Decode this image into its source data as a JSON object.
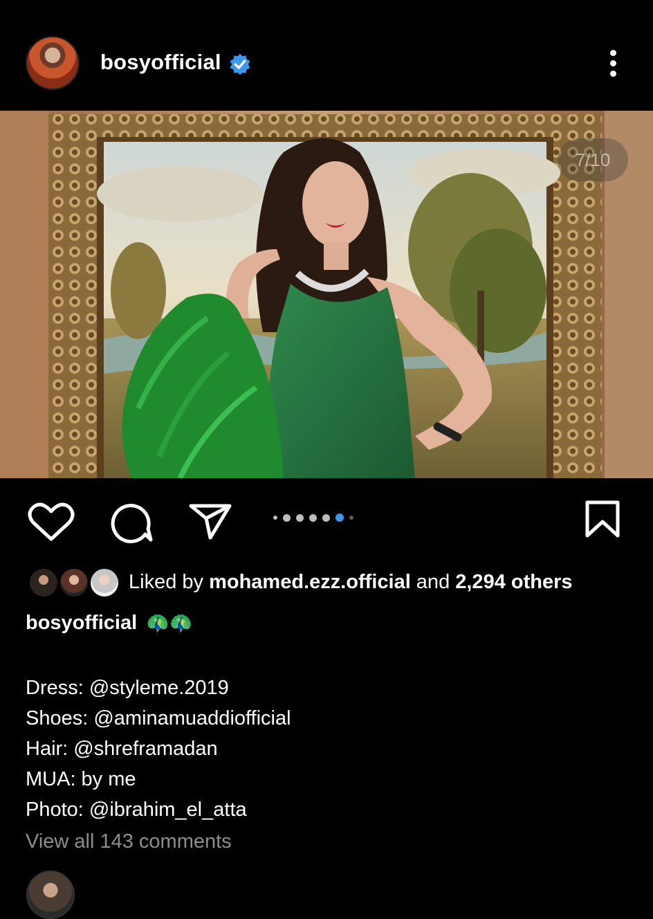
{
  "header": {
    "username": "bosyofficial",
    "verified": true,
    "accent_color": "#3897f0"
  },
  "post": {
    "counter": "7/10",
    "carousel": {
      "total_dots": 7,
      "active_index": 5
    }
  },
  "likes": {
    "prefix": "Liked by ",
    "user": "mohamed.ezz.official",
    "middle": " and ",
    "others": "2,294 others"
  },
  "caption": {
    "username": "bosyofficial",
    "emoji": "🦚🦚",
    "lines": [
      "Dress: @styleme.2019",
      "Shoes: @aminamuaddiofficial",
      "Hair: @shreframadan",
      "MUA: by me",
      "Photo: @ibrahim_el_atta"
    ]
  },
  "comments": {
    "view_all": "View all 143 comments"
  },
  "icons": {
    "like": "heart-icon",
    "comment": "comment-icon",
    "share": "send-icon",
    "save": "bookmark-icon",
    "more": "more-vertical-icon"
  }
}
